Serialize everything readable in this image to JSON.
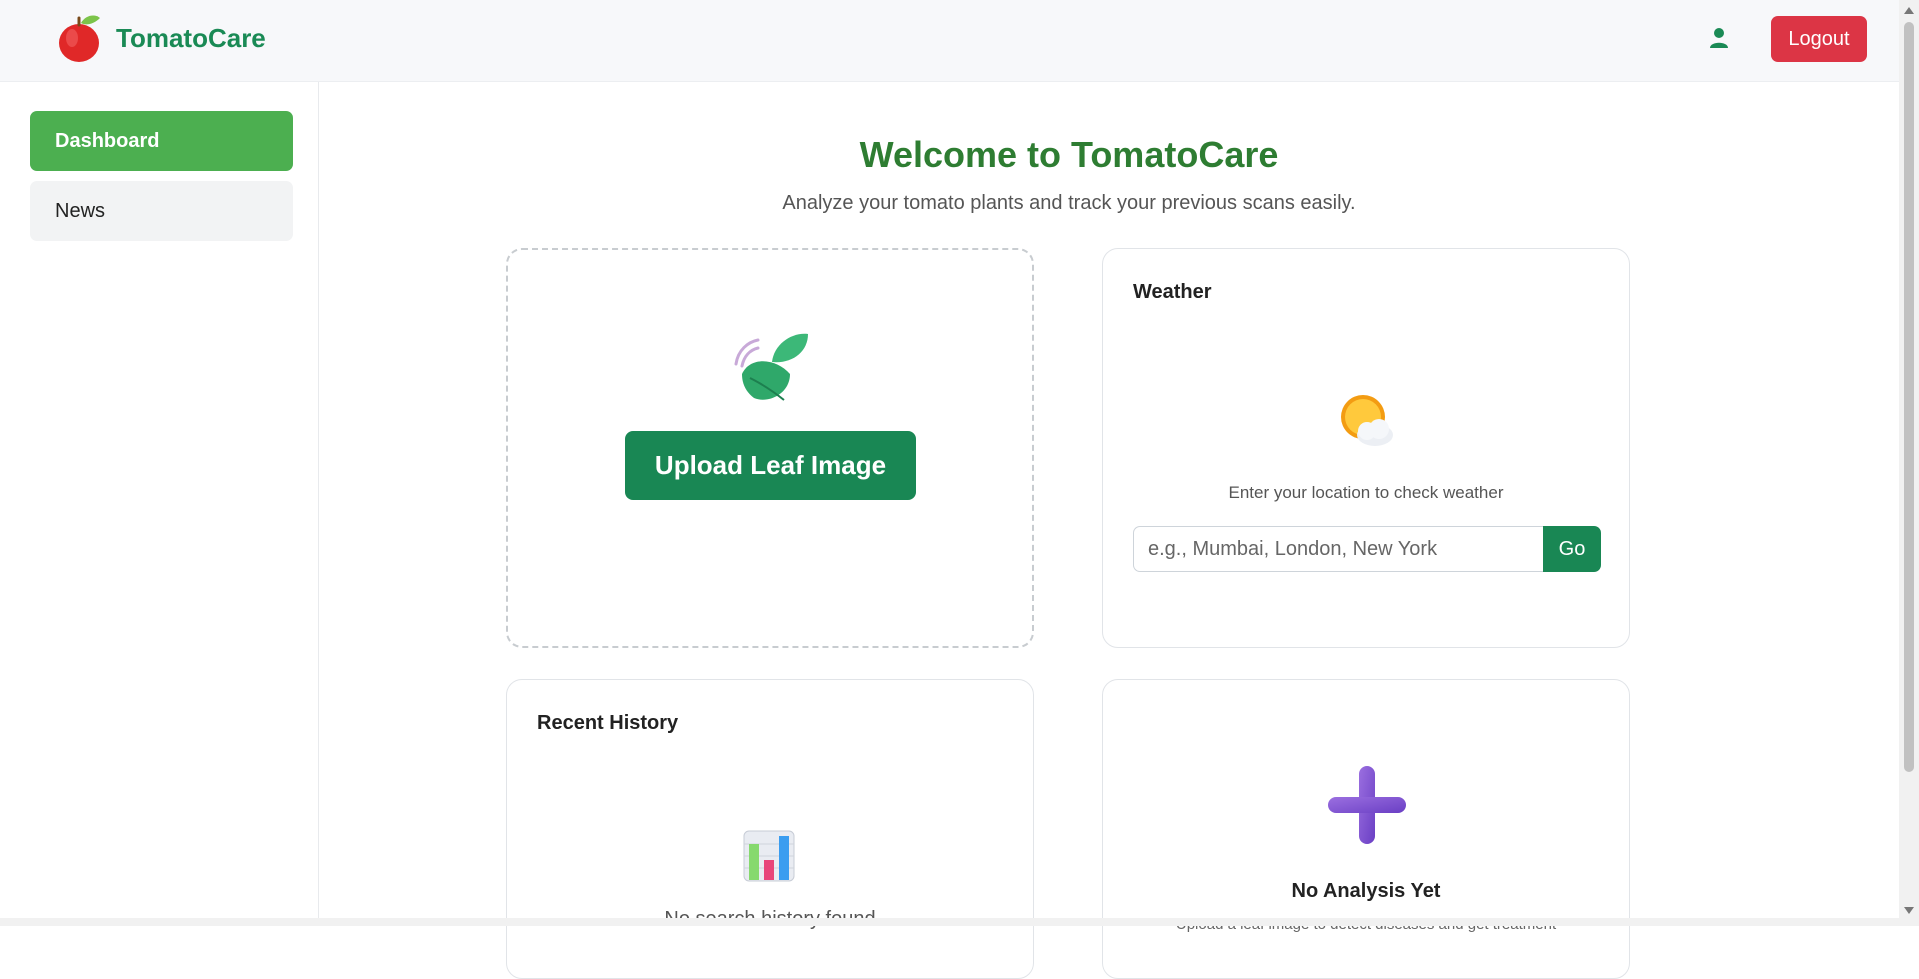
{
  "header": {
    "brand_name": "TomatoCare",
    "logo_icon": "tomato-icon",
    "user_icon": "user-icon",
    "logout_label": "Logout"
  },
  "sidebar": {
    "items": [
      {
        "label": "Dashboard",
        "active": true
      },
      {
        "label": "News",
        "active": false
      }
    ]
  },
  "main": {
    "title": "Welcome to TomatoCare",
    "subtitle": "Analyze your tomato plants and track your previous scans easily.",
    "upload": {
      "icon": "leaf-icon",
      "button_label": "Upload Leaf Image"
    },
    "weather": {
      "title": "Weather",
      "icon": "sun-cloud-icon",
      "prompt": "Enter your location to check weather",
      "input_placeholder": "e.g., Mumbai, London, New York",
      "input_value": "",
      "go_label": "Go"
    },
    "history": {
      "title": "Recent History",
      "icon": "bar-chart-icon",
      "empty_text": "No search history found"
    },
    "analysis": {
      "icon": "plus-icon",
      "title": "No Analysis Yet",
      "description": "Upload a leaf image to detect diseases and get treatment"
    }
  },
  "colors": {
    "brand_green": "#1a8a55",
    "title_green": "#2e7d32",
    "sidebar_active": "#4caf50",
    "button_green": "#198754",
    "logout_red": "#dc3545"
  }
}
